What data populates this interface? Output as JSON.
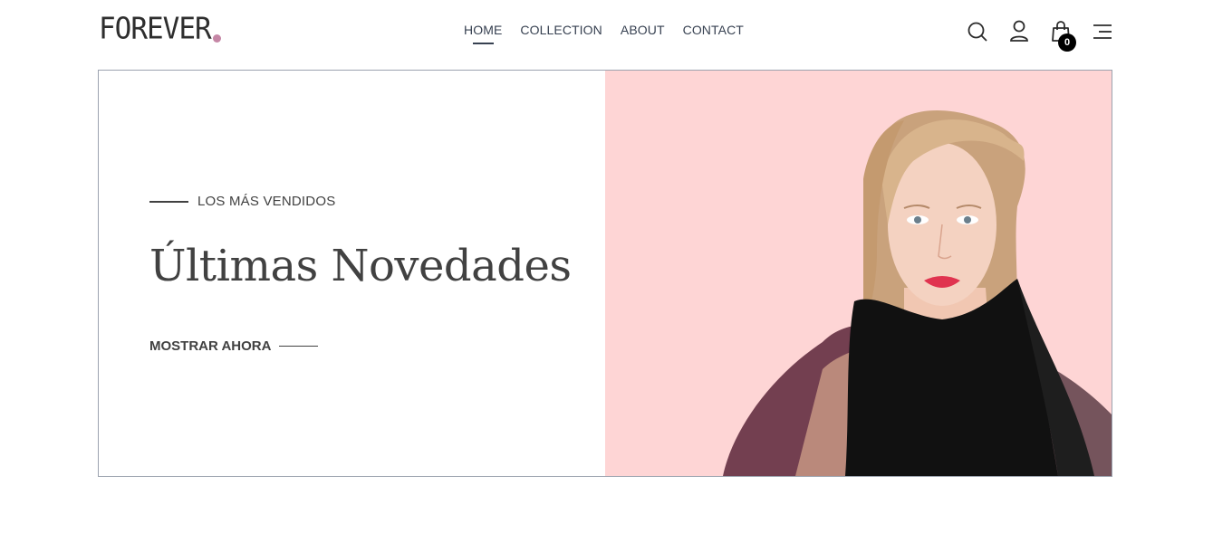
{
  "header": {
    "logo_text": "FOREVER",
    "nav": [
      {
        "label": "HOME",
        "active": true
      },
      {
        "label": "COLLECTION",
        "active": false
      },
      {
        "label": "ABOUT",
        "active": false
      },
      {
        "label": "CONTACT",
        "active": false
      }
    ],
    "icons": [
      "search-icon",
      "profile-icon",
      "cart-icon",
      "menu-icon"
    ],
    "cart_count": "0"
  },
  "hero": {
    "eyebrow": "LOS MÁS VENDIDOS",
    "title": "Últimas Novedades",
    "cta": "MOSTRAR AHORA",
    "image_background": "#fed5d5"
  },
  "colors": {
    "text": "#414141",
    "logo_dot": "#c586a5",
    "hero_pink": "#fed5d5",
    "badge": "#000000"
  }
}
